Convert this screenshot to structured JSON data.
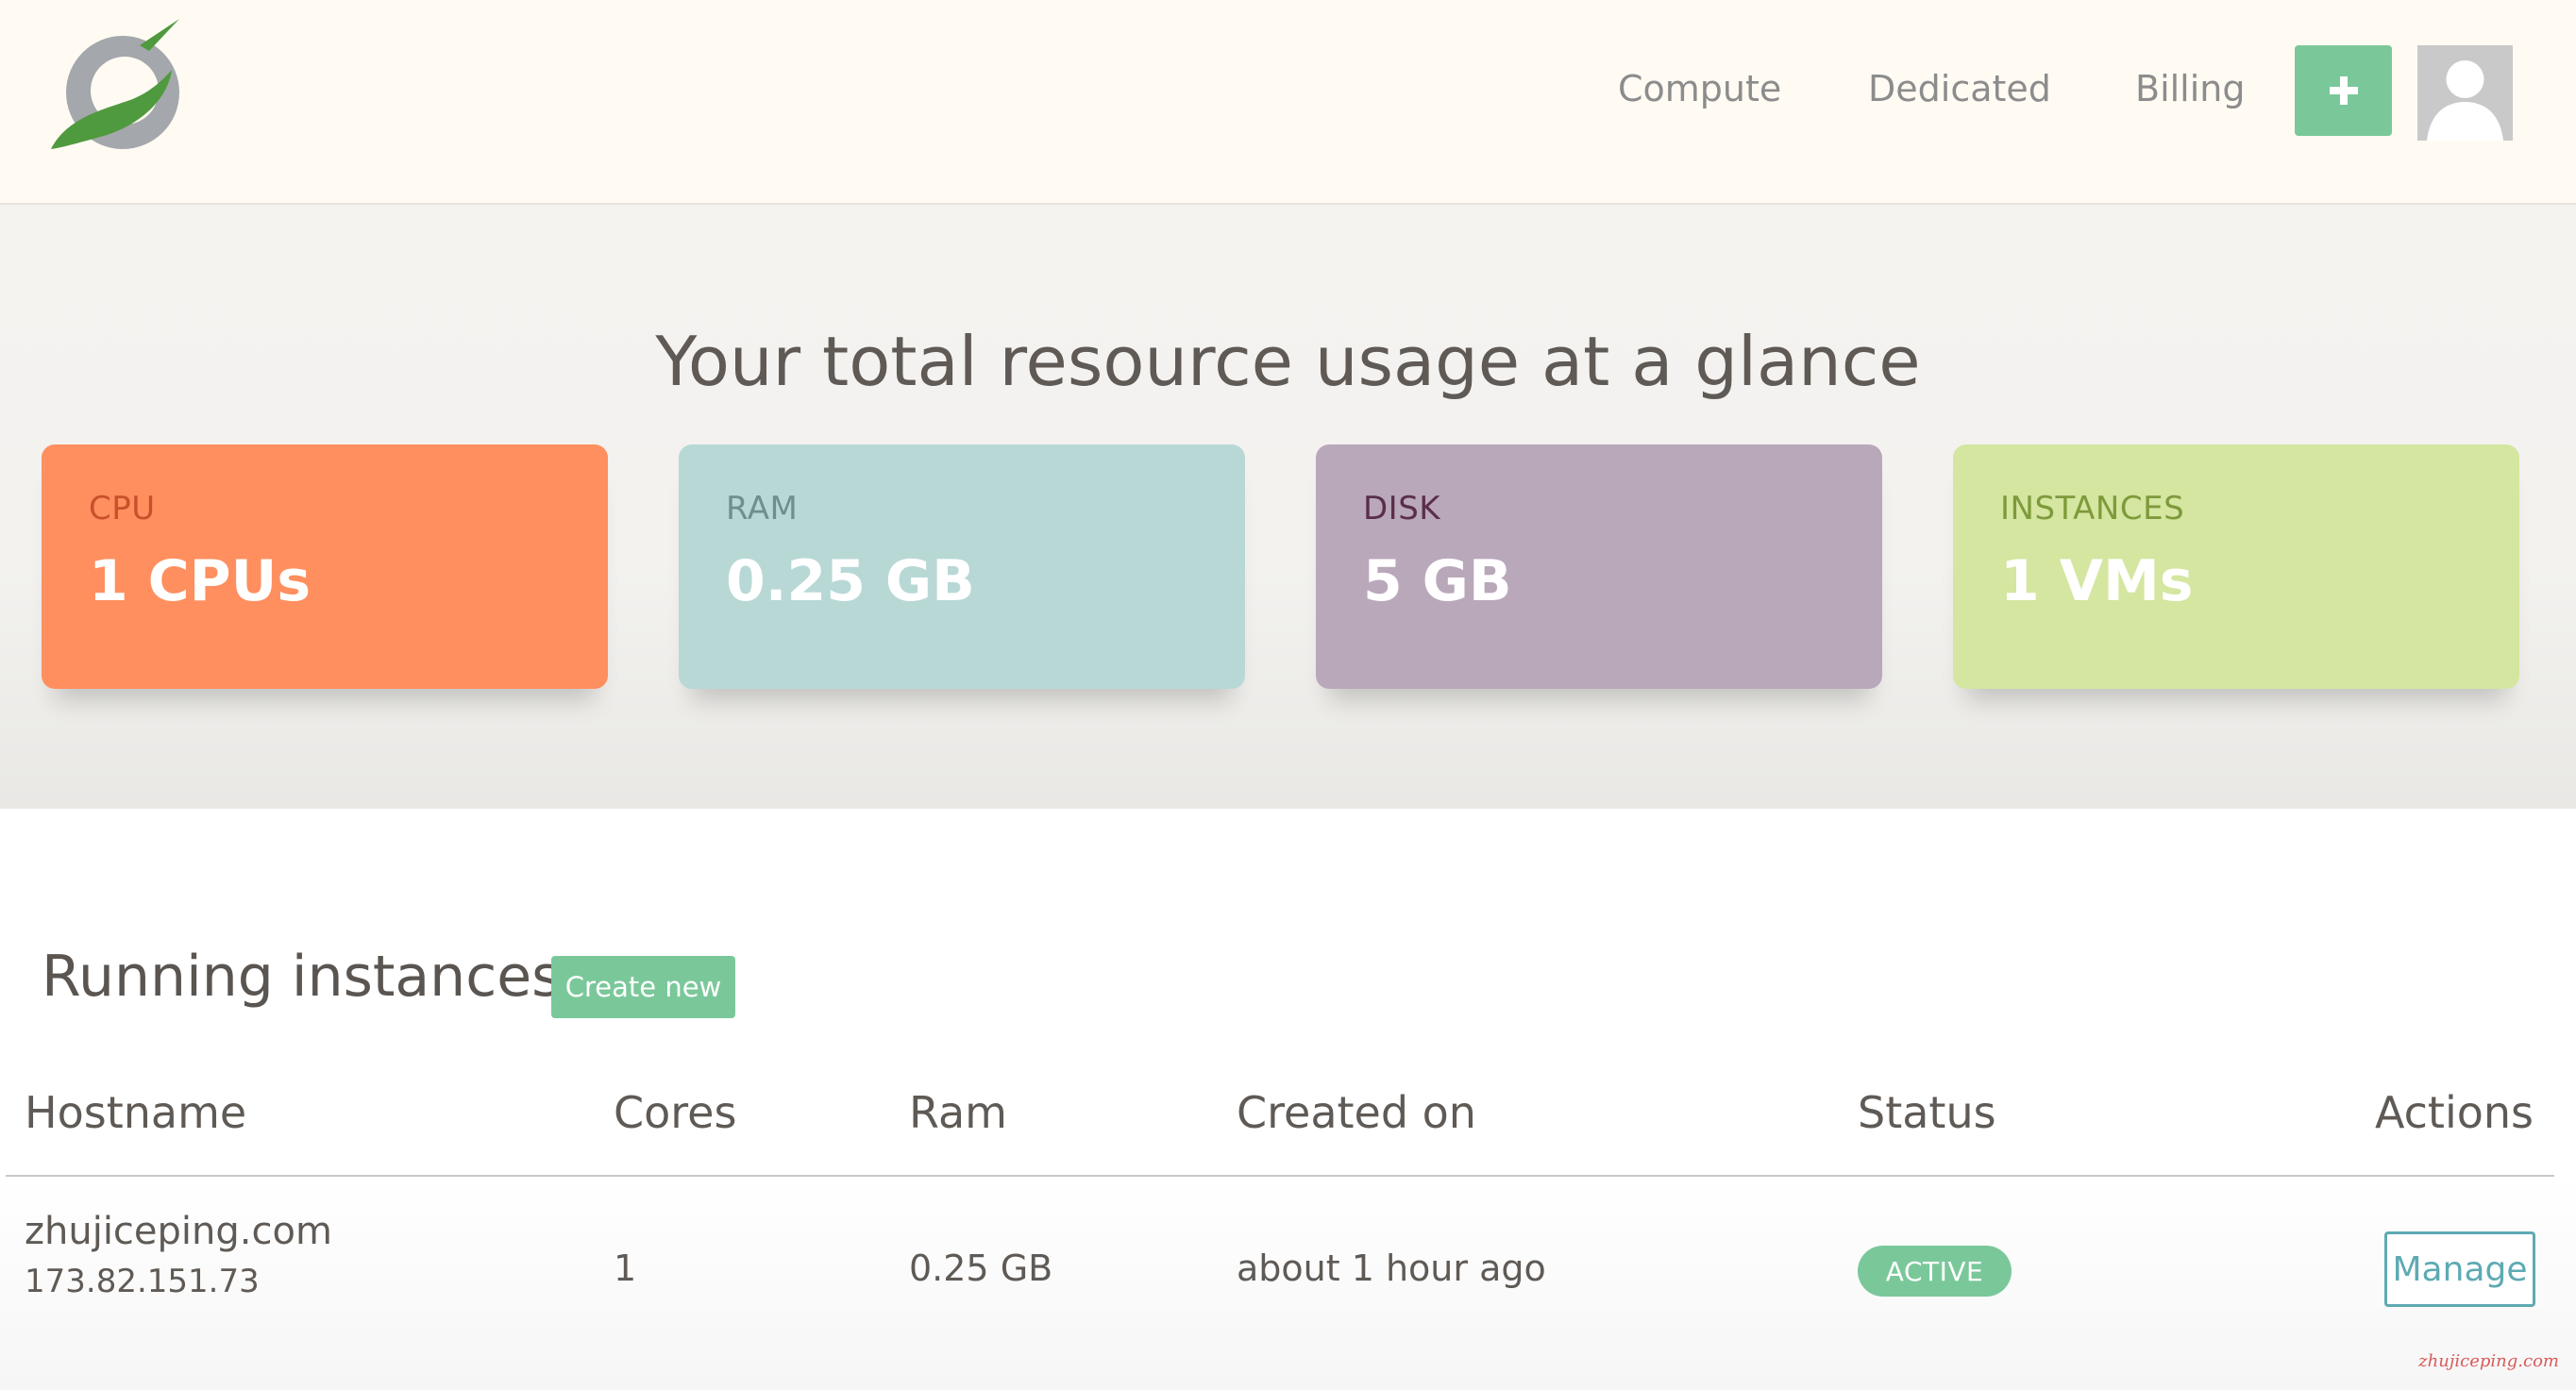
{
  "nav": {
    "compute": "Compute",
    "dedicated": "Dedicated",
    "billing": "Billing",
    "add_icon": "plus-icon",
    "avatar_icon": "user-avatar-icon"
  },
  "hero": {
    "title": "Your total resource usage at a glance"
  },
  "stats": [
    {
      "label": "CPU",
      "value": "1 CPUs",
      "color": "#ff8f5e"
    },
    {
      "label": "RAM",
      "value": "0.25 GB",
      "color": "#b8d8d6"
    },
    {
      "label": "DISK",
      "value": "5 GB",
      "color": "#b9a8ba"
    },
    {
      "label": "INSTANCES",
      "value": "1 VMs",
      "color": "#d4e6a0"
    }
  ],
  "instances": {
    "title": "Running instances",
    "create_label": "Create new",
    "columns": [
      "Hostname",
      "Cores",
      "Ram",
      "Created on",
      "Status",
      "Actions"
    ],
    "rows": [
      {
        "hostname": "zhujiceping.com",
        "ip": "173.82.151.73",
        "cores": "1",
        "ram": "0.25 GB",
        "created": "about 1 hour ago",
        "status": "ACTIVE",
        "action": "Manage"
      }
    ]
  },
  "watermark": "zhujiceping.com",
  "colors": {
    "accent_green": "#7ac89a",
    "manage_teal": "#5eaab3"
  }
}
